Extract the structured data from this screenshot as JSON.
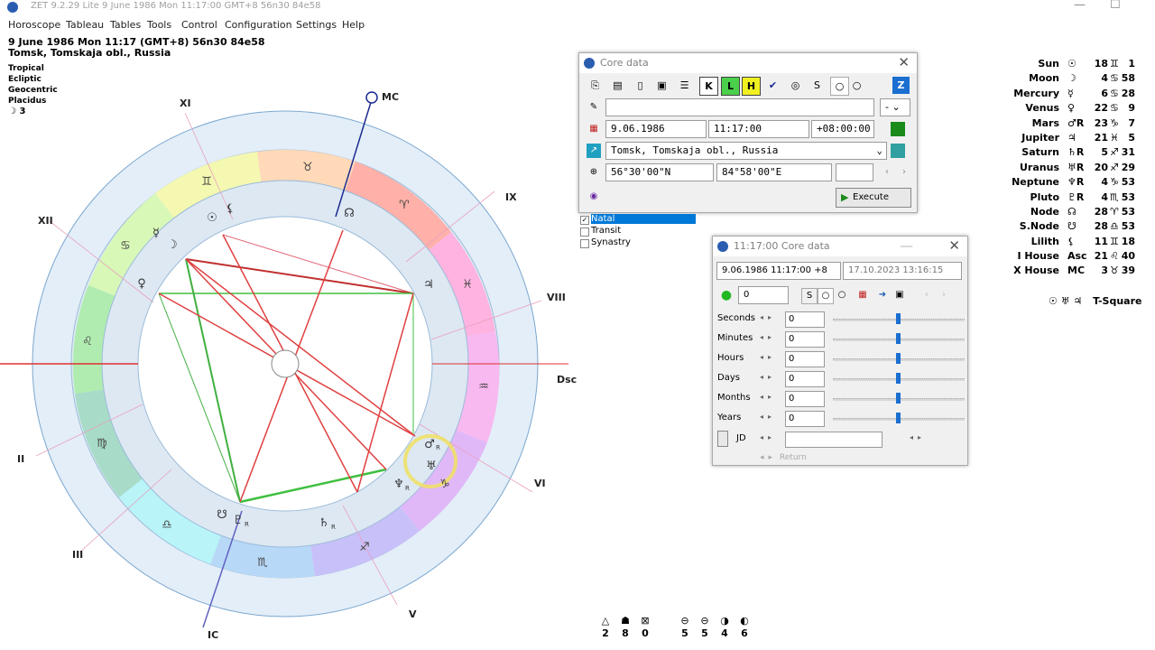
{
  "window": {
    "title": "ZET 9.2.29 Lite    9 June 1986  Mon  11:17:00 GMT+8 56n30  84e58"
  },
  "menu": [
    "Horoscope",
    "Tableau",
    "Tables",
    "Tools",
    "Control",
    "Configuration",
    "Settings",
    "Help"
  ],
  "chart_header": {
    "line1": "9 June 1986  Mon  11:17  (GMT+8) 56n30  84e58",
    "line2": "Tomsk, Tomskaja obl., Russia",
    "settings": [
      "Tropical",
      "Ecliptic",
      "Geocentric",
      "Placidus"
    ],
    "moon_phase": "☽  3"
  },
  "wheel": {
    "angles": [
      "MC",
      "Dsc",
      "IC"
    ],
    "houses": [
      "XI",
      "XII",
      "II",
      "III",
      "V",
      "VI",
      "VIII",
      "IX"
    ],
    "signs": [
      "♉",
      "♈",
      "♓",
      "♒",
      "♑",
      "♐",
      "♏",
      "♎",
      "♍",
      "♌",
      "♋",
      "♊"
    ],
    "planet_glyphs": [
      "☉",
      "⚸",
      "☽",
      "☿",
      "♀",
      "♃",
      "☊",
      "♂",
      "♅",
      "♄",
      "♆",
      "☋",
      "♇"
    ],
    "retro_marker": "R"
  },
  "planets": [
    {
      "name": "Sun",
      "glyph": "☉",
      "deg": "18",
      "sign": "♊",
      "min": "1"
    },
    {
      "name": "Moon",
      "glyph": "☽",
      "deg": "4",
      "sign": "♋",
      "min": "58"
    },
    {
      "name": "Mercury",
      "glyph": "☿",
      "deg": "6",
      "sign": "♋",
      "min": "28"
    },
    {
      "name": "Venus",
      "glyph": "♀",
      "deg": "22",
      "sign": "♋",
      "min": "9"
    },
    {
      "name": "Mars",
      "glyph": "♂R",
      "deg": "23",
      "sign": "♑",
      "min": "7"
    },
    {
      "name": "Jupiter",
      "glyph": "♃",
      "deg": "21",
      "sign": "♓",
      "min": "5"
    },
    {
      "name": "Saturn",
      "glyph": "♄R",
      "deg": "5",
      "sign": "♐",
      "min": "31"
    },
    {
      "name": "Uranus",
      "glyph": "♅R",
      "deg": "20",
      "sign": "♐",
      "min": "29"
    },
    {
      "name": "Neptune",
      "glyph": "♆R",
      "deg": "4",
      "sign": "♑",
      "min": "53"
    },
    {
      "name": "Pluto",
      "glyph": "♇R",
      "deg": "4",
      "sign": "♏",
      "min": "53"
    },
    {
      "name": "Node",
      "glyph": "☊",
      "deg": "28",
      "sign": "♈",
      "min": "53"
    },
    {
      "name": "S.Node",
      "glyph": "☋",
      "deg": "28",
      "sign": "♎",
      "min": "53"
    },
    {
      "name": "Lilith",
      "glyph": "⚸",
      "deg": "11",
      "sign": "♊",
      "min": "18"
    },
    {
      "name": "I House",
      "glyph": "Asc",
      "deg": "21",
      "sign": "♌",
      "min": "40"
    },
    {
      "name": "X House",
      "glyph": "MC",
      "deg": "3",
      "sign": "♉",
      "min": "39"
    }
  ],
  "t_square": {
    "glyphs": "☉ ♅ ♃",
    "label": "T-Square"
  },
  "core_dialog": {
    "title": "Core data",
    "date": "9.06.1986",
    "time": "11:17:00",
    "zone": "+08:00:00",
    "place": "Tomsk, Tomskaja obl., Russia",
    "lat": "56°30'00\"N",
    "lon": "84°58'00\"E",
    "dash_option": "-",
    "execute": "Execute"
  },
  "chart_list": [
    "Natal",
    "Transit",
    "Synastry"
  ],
  "time_dialog": {
    "title": "11:17:00 Core data",
    "current": "9.06.1986  11:17:00  +8",
    "now": "17.10.2023   13:16:15",
    "step_value": "0",
    "rows": [
      {
        "label": "Seconds",
        "value": "0"
      },
      {
        "label": "Minutes",
        "value": "0"
      },
      {
        "label": "Hours",
        "value": "0"
      },
      {
        "label": "Days",
        "value": "0"
      },
      {
        "label": "Months",
        "value": "0"
      },
      {
        "label": "Years",
        "value": "0"
      }
    ],
    "jd_label": "JD",
    "return_label": "Return"
  },
  "aspect_counts": [
    {
      "glyph": "△",
      "count": "2"
    },
    {
      "glyph": "☗",
      "count": "8"
    },
    {
      "glyph": "⊠",
      "count": "0"
    },
    {
      "glyph": "⊖",
      "count": "5"
    },
    {
      "glyph": "⊖",
      "count": "5"
    },
    {
      "glyph": "◑",
      "count": "4"
    },
    {
      "glyph": "◐",
      "count": "6"
    }
  ]
}
